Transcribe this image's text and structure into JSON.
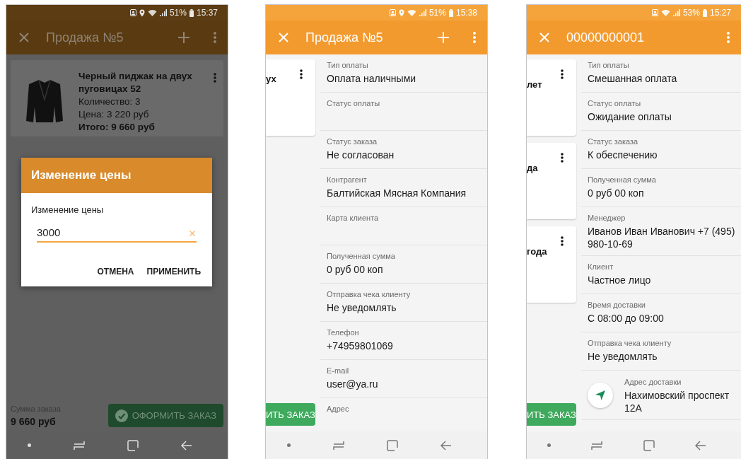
{
  "phones": [
    {
      "kind": "cart",
      "dimmed": true,
      "status": {
        "location": true,
        "battery": "51%",
        "time": "15:37"
      },
      "toolbar": {
        "title": "Продажа №5",
        "add": true
      },
      "product": {
        "name": "Черный пиджак на двух пуговицах 52",
        "quantity": "Количество: 3",
        "price": "Цена: 3 220 руб",
        "total": "Итого: 9 660 руб"
      },
      "dialog": {
        "title": "Изменение цены",
        "label": "Изменение цены",
        "value": "3000",
        "buttons": [
          "ОТМЕНА",
          "ПРИМЕНИТЬ"
        ]
      },
      "footer": {
        "label": "Сумма заказа",
        "total": "9 660 руб",
        "button": "ОФОРМИТЬ ЗАКАЗ"
      }
    },
    {
      "kind": "details",
      "dimmed": false,
      "status": {
        "location": true,
        "battery": "51%",
        "time": "15:38"
      },
      "toolbar": {
        "title": "Продажа №5",
        "add": true
      },
      "cards": [
        {
          "text": "ух"
        }
      ],
      "button": "ИТЬ ЗАКАЗ",
      "fields": [
        {
          "kind": "text",
          "label": "Тип оплаты",
          "value": "Оплата наличными"
        },
        {
          "kind": "text",
          "label": "Статус оплаты"
        },
        {
          "kind": "text",
          "label": "Статус заказа",
          "value": "Не согласован"
        },
        {
          "kind": "text",
          "label": "Контрагент",
          "value": "Балтийская Мясная Компания"
        },
        {
          "kind": "text",
          "label": "Карта клиента"
        },
        {
          "kind": "text",
          "label": "Полученная сумма",
          "value": "0 руб 00 коп"
        },
        {
          "kind": "text",
          "label": "Отправка чека клиенту",
          "value": "Не уведомлять"
        },
        {
          "kind": "text",
          "label": "Телефон",
          "value": "+74959801069"
        },
        {
          "kind": "text",
          "label": "E-mail",
          "value": "user@ya.ru"
        },
        {
          "kind": "text",
          "label": "Адрес"
        }
      ]
    },
    {
      "kind": "details",
      "dimmed": false,
      "status": {
        "location": false,
        "battery": "53%",
        "time": "15:27"
      },
      "toolbar": {
        "title": "00000000001",
        "add": false
      },
      "cards": [
        {
          "text": "лет"
        },
        {
          "text": "да"
        },
        {
          "text": "года"
        }
      ],
      "button": "ИТЬ ЗАКАЗ",
      "fields": [
        {
          "kind": "text",
          "label": "Тип оплаты",
          "value": "Смешанная оплата"
        },
        {
          "kind": "text",
          "label": "Статус оплаты",
          "value": "Ожидание оплаты"
        },
        {
          "kind": "text",
          "label": "Статус заказа",
          "value": "К обеспечению"
        },
        {
          "kind": "text",
          "label": "Полученная сумма",
          "value": "0 руб 00 коп"
        },
        {
          "kind": "text",
          "label": "Менеджер",
          "value": "Иванов Иван Иванович +7 (495) 980-10-69"
        },
        {
          "kind": "text",
          "label": "Клиент",
          "value": "Частное лицо"
        },
        {
          "kind": "text",
          "label": "Время доставки",
          "value": "С 08:00 до 09:00"
        },
        {
          "kind": "text",
          "label": "Отправка чека клиенту",
          "value": "Не уведомлять"
        },
        {
          "kind": "address",
          "label": "Адрес доставки",
          "value": "Нахимовский проспект 12А"
        }
      ]
    }
  ]
}
